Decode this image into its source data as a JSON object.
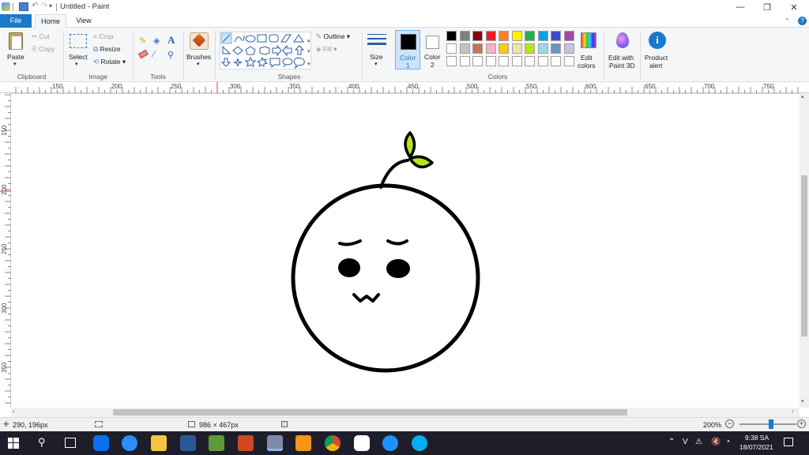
{
  "window": {
    "title": "Untitled - Paint",
    "minimize": "—",
    "restore": "❐",
    "close": "✕"
  },
  "tabs": {
    "file": "File",
    "home": "Home",
    "view": "View"
  },
  "ribbon": {
    "clipboard": {
      "label": "Clipboard",
      "paste": "Paste",
      "cut": "Cut",
      "copy": "Copy"
    },
    "image": {
      "label": "Image",
      "select": "Select",
      "crop": "Crop",
      "resize": "Resize",
      "rotate": "Rotate"
    },
    "tools": {
      "label": "Tools"
    },
    "brushes": {
      "label": "Brushes"
    },
    "shapes": {
      "label": "Shapes",
      "outline": "Outline",
      "fill": "Fill"
    },
    "size": {
      "label": "Size"
    },
    "color1": {
      "label": "Color",
      "num": "1"
    },
    "color2": {
      "label": "Color",
      "num": "2"
    },
    "colors": {
      "label": "Colors"
    },
    "edit_colors": {
      "line1": "Edit",
      "line2": "colors"
    },
    "paint3d": {
      "line1": "Edit with",
      "line2": "Paint 3D"
    },
    "product_alert": {
      "line1": "Product",
      "line2": "alert"
    }
  },
  "palette": {
    "row1": [
      "#000000",
      "#7f7f7f",
      "#880015",
      "#ed1c24",
      "#ff7f27",
      "#fff200",
      "#22b14c",
      "#00a2e8",
      "#3f48cc",
      "#a349a4"
    ],
    "row2": [
      "#ffffff",
      "#c3c3c3",
      "#b97a57",
      "#ffaec9",
      "#ffc90e",
      "#efe4b0",
      "#b5e61d",
      "#99d9ea",
      "#7092be",
      "#c8bfe7"
    ],
    "row3": [
      "#ffffff",
      "#ffffff",
      "#ffffff",
      "#ffffff",
      "#ffffff",
      "#ffffff",
      "#ffffff",
      "#ffffff",
      "#ffffff",
      "#ffffff"
    ]
  },
  "ruler": {
    "h": [
      "150",
      "200",
      "250",
      "300",
      "350",
      "400",
      "450",
      "500",
      "550",
      "600",
      "650",
      "700",
      "750"
    ],
    "v": [
      "150",
      "200",
      "250",
      "300",
      "350"
    ]
  },
  "status": {
    "cursor": "290, 196px",
    "canvas_size": "986 × 467px",
    "zoom": "200%"
  },
  "zoom_slider": {
    "level_fraction": 0.55
  },
  "taskbar": {
    "time": "9:38 SA",
    "date": "18/07/2021",
    "tray_v": "V"
  },
  "colors": {
    "accent": "#1979ca",
    "leaf": "#b5e61d"
  }
}
